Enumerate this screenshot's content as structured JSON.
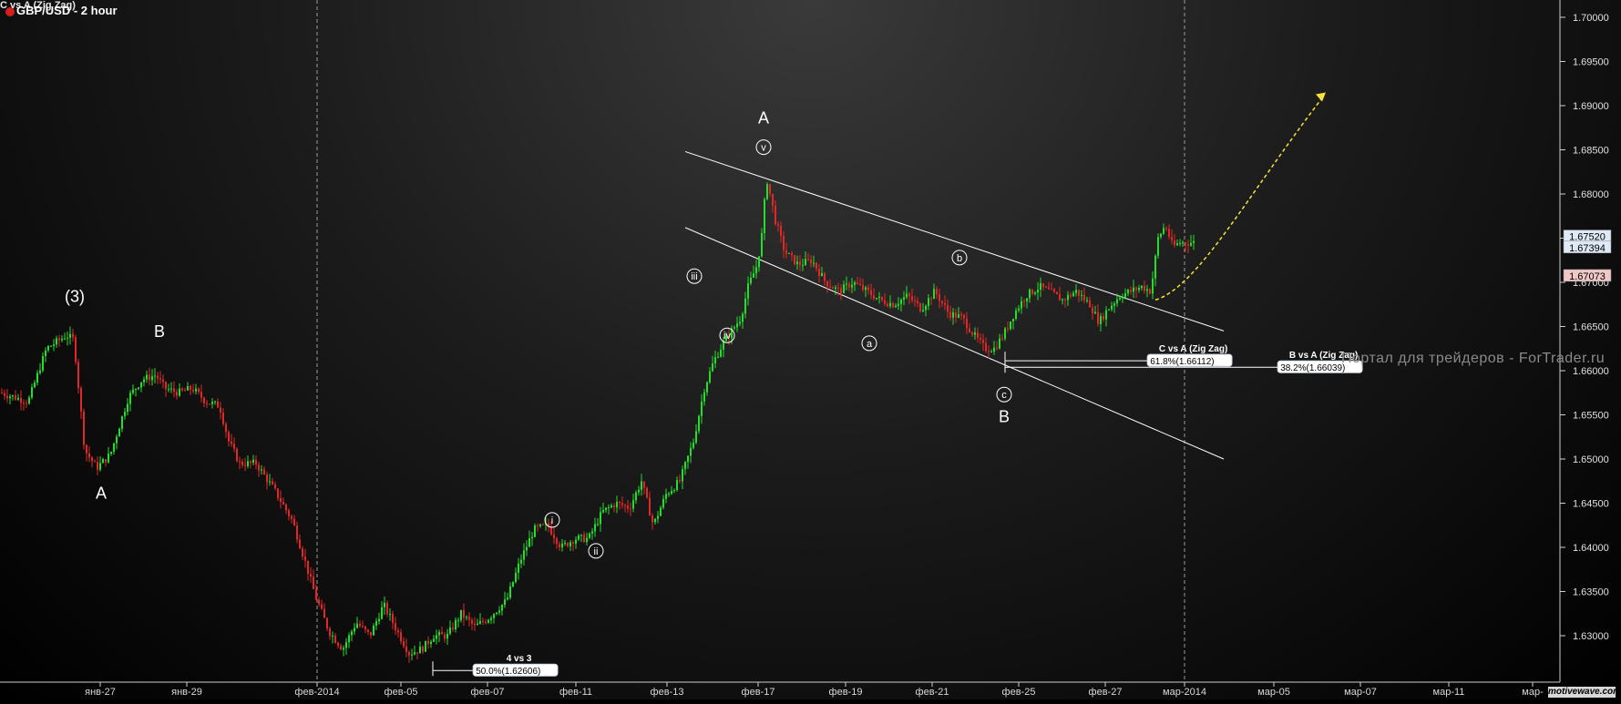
{
  "header": {
    "indicator_label": "C vs A (Zig Zag)",
    "title": "GBP/USD - 2 hour"
  },
  "watermark": "Портал для трейдеров - ForTrader.ru",
  "logo": "motivewave.com",
  "colors": {
    "up_candle": "#22e02a",
    "down_candle": "#e12727",
    "line": "#ffffff",
    "projection": "#f5e23a",
    "price_box_bg": "#dfe8f5",
    "price_box_red": "#f0c8c8"
  },
  "chart_data": {
    "type": "candlestick",
    "instrument": "GBP/USD",
    "timeframe": "2 hour",
    "ylim": [
      1.6235,
      1.7015
    ],
    "yticks": [
      "1.70000",
      "1.69500",
      "1.69000",
      "1.68500",
      "1.68000",
      "1.67500",
      "1.67000",
      "1.66500",
      "1.66000",
      "1.65500",
      "1.65000",
      "1.64500",
      "1.64000",
      "1.63500",
      "1.63000"
    ],
    "xticks": [
      "янв-27",
      "янв-29",
      "фев-2014",
      "фев-05",
      "фев-07",
      "фев-11",
      "фев-13",
      "фев-17",
      "фев-19",
      "фев-21",
      "фев-25",
      "фев-27",
      "мар-2014",
      "мар-05",
      "мар-07",
      "мар-11",
      "мар-"
    ],
    "price_path": [
      [
        0,
        1.6575
      ],
      [
        30,
        1.6565
      ],
      [
        50,
        1.6625
      ],
      [
        72,
        1.664
      ],
      [
        80,
        1.6635
      ],
      [
        92,
        1.651
      ],
      [
        105,
        1.649
      ],
      [
        120,
        1.6505
      ],
      [
        140,
        1.657
      ],
      [
        155,
        1.659
      ],
      [
        170,
        1.6595
      ],
      [
        180,
        1.658
      ],
      [
        195,
        1.6575
      ],
      [
        210,
        1.658
      ],
      [
        225,
        1.6565
      ],
      [
        240,
        1.656
      ],
      [
        250,
        1.652
      ],
      [
        262,
        1.6495
      ],
      [
        280,
        1.6495
      ],
      [
        300,
        1.6465
      ],
      [
        320,
        1.643
      ],
      [
        335,
        1.638
      ],
      [
        345,
        1.6345
      ],
      [
        360,
        1.6305
      ],
      [
        375,
        1.6285
      ],
      [
        390,
        1.6315
      ],
      [
        405,
        1.63
      ],
      [
        420,
        1.6335
      ],
      [
        435,
        1.6305
      ],
      [
        448,
        1.628
      ],
      [
        462,
        1.6285
      ],
      [
        475,
        1.63
      ],
      [
        490,
        1.63
      ],
      [
        505,
        1.6325
      ],
      [
        520,
        1.631
      ],
      [
        535,
        1.632
      ],
      [
        555,
        1.634
      ],
      [
        570,
        1.6385
      ],
      [
        585,
        1.642
      ],
      [
        600,
        1.6425
      ],
      [
        615,
        1.64
      ],
      [
        630,
        1.641
      ],
      [
        645,
        1.641
      ],
      [
        660,
        1.644
      ],
      [
        675,
        1.645
      ],
      [
        690,
        1.6445
      ],
      [
        703,
        1.6475
      ],
      [
        716,
        1.6425
      ],
      [
        730,
        1.646
      ],
      [
        745,
        1.6475
      ],
      [
        760,
        1.652
      ],
      [
        772,
        1.658
      ],
      [
        782,
        1.661
      ],
      [
        792,
        1.663
      ],
      [
        802,
        1.6645
      ],
      [
        812,
        1.666
      ],
      [
        820,
        1.6695
      ],
      [
        830,
        1.672
      ],
      [
        836,
        1.676
      ],
      [
        840,
        1.682
      ],
      [
        845,
        1.6795
      ],
      [
        850,
        1.677
      ],
      [
        860,
        1.6735
      ],
      [
        875,
        1.672
      ],
      [
        890,
        1.6725
      ],
      [
        905,
        1.67
      ],
      [
        920,
        1.669
      ],
      [
        935,
        1.67
      ],
      [
        950,
        1.669
      ],
      [
        965,
        1.668
      ],
      [
        980,
        1.6675
      ],
      [
        995,
        1.6685
      ],
      [
        1010,
        1.667
      ],
      [
        1025,
        1.669
      ],
      [
        1040,
        1.6665
      ],
      [
        1055,
        1.666
      ],
      [
        1068,
        1.664
      ],
      [
        1080,
        1.6625
      ],
      [
        1090,
        1.6625
      ],
      [
        1100,
        1.664
      ],
      [
        1112,
        1.6665
      ],
      [
        1125,
        1.6685
      ],
      [
        1140,
        1.6695
      ],
      [
        1150,
        1.669
      ],
      [
        1165,
        1.668
      ],
      [
        1180,
        1.669
      ],
      [
        1195,
        1.6675
      ],
      [
        1205,
        1.6655
      ],
      [
        1215,
        1.667
      ],
      [
        1228,
        1.6685
      ],
      [
        1240,
        1.669
      ],
      [
        1252,
        1.6695
      ],
      [
        1262,
        1.669
      ],
      [
        1270,
        1.675
      ],
      [
        1278,
        1.6765
      ],
      [
        1286,
        1.674
      ],
      [
        1294,
        1.6745
      ],
      [
        1302,
        1.6745
      ],
      [
        1310,
        1.6745
      ]
    ],
    "last_prices": [
      "1.67520",
      "1.67394",
      "1.67073"
    ],
    "channel": {
      "upper": [
        [
          752,
          1.6848
        ],
        [
          1343,
          1.6645
        ]
      ],
      "lower": [
        [
          752,
          1.6762
        ],
        [
          1343,
          1.65
        ]
      ]
    },
    "projection": [
      [
        1268,
        1.668
      ],
      [
        1300,
        1.67
      ],
      [
        1340,
        1.677
      ],
      [
        1372,
        1.688
      ],
      [
        1455,
        1.6915
      ]
    ],
    "vlines_x": [
      348,
      1300
    ],
    "wave_labels": [
      {
        "text": "(3)",
        "x": 82,
        "price": 1.6678,
        "style": "plain"
      },
      {
        "text": "A",
        "x": 111,
        "price": 1.6455,
        "style": "plain"
      },
      {
        "text": "B",
        "x": 175,
        "price": 1.6638,
        "style": "plain"
      },
      {
        "text": "A",
        "x": 838,
        "price": 1.688,
        "style": "plain"
      },
      {
        "text": "B",
        "x": 1102,
        "price": 1.6542,
        "style": "plain"
      },
      {
        "text": "v",
        "x": 838,
        "price": 1.6853,
        "style": "circle"
      },
      {
        "text": "iii",
        "x": 762,
        "price": 1.6707,
        "style": "circle"
      },
      {
        "text": "iv",
        "x": 798,
        "price": 1.664,
        "style": "circle"
      },
      {
        "text": "i",
        "x": 606,
        "price": 1.6431,
        "style": "circle"
      },
      {
        "text": "ii",
        "x": 654,
        "price": 1.6396,
        "style": "circle"
      },
      {
        "text": "a",
        "x": 954,
        "price": 1.6631,
        "style": "circle"
      },
      {
        "text": "b",
        "x": 1053,
        "price": 1.6728,
        "style": "circle"
      },
      {
        "text": "c",
        "x": 1102,
        "price": 1.6573,
        "style": "circle"
      }
    ],
    "fib_annotations": [
      {
        "title": "C vs A (Zig Zag)",
        "label": "61.8%(1.66112)",
        "price": 1.66112,
        "x1": 1103,
        "x2": 1352
      },
      {
        "title": "B vs A (Zig Zag)",
        "label": "38.2%(1.66039)",
        "price": 1.66039,
        "x1": 1103,
        "x2": 1495
      },
      {
        "title": "4 vs 3",
        "label": "50.0%(1.62606)",
        "price": 1.62606,
        "x1": 475,
        "x2": 612
      }
    ]
  }
}
